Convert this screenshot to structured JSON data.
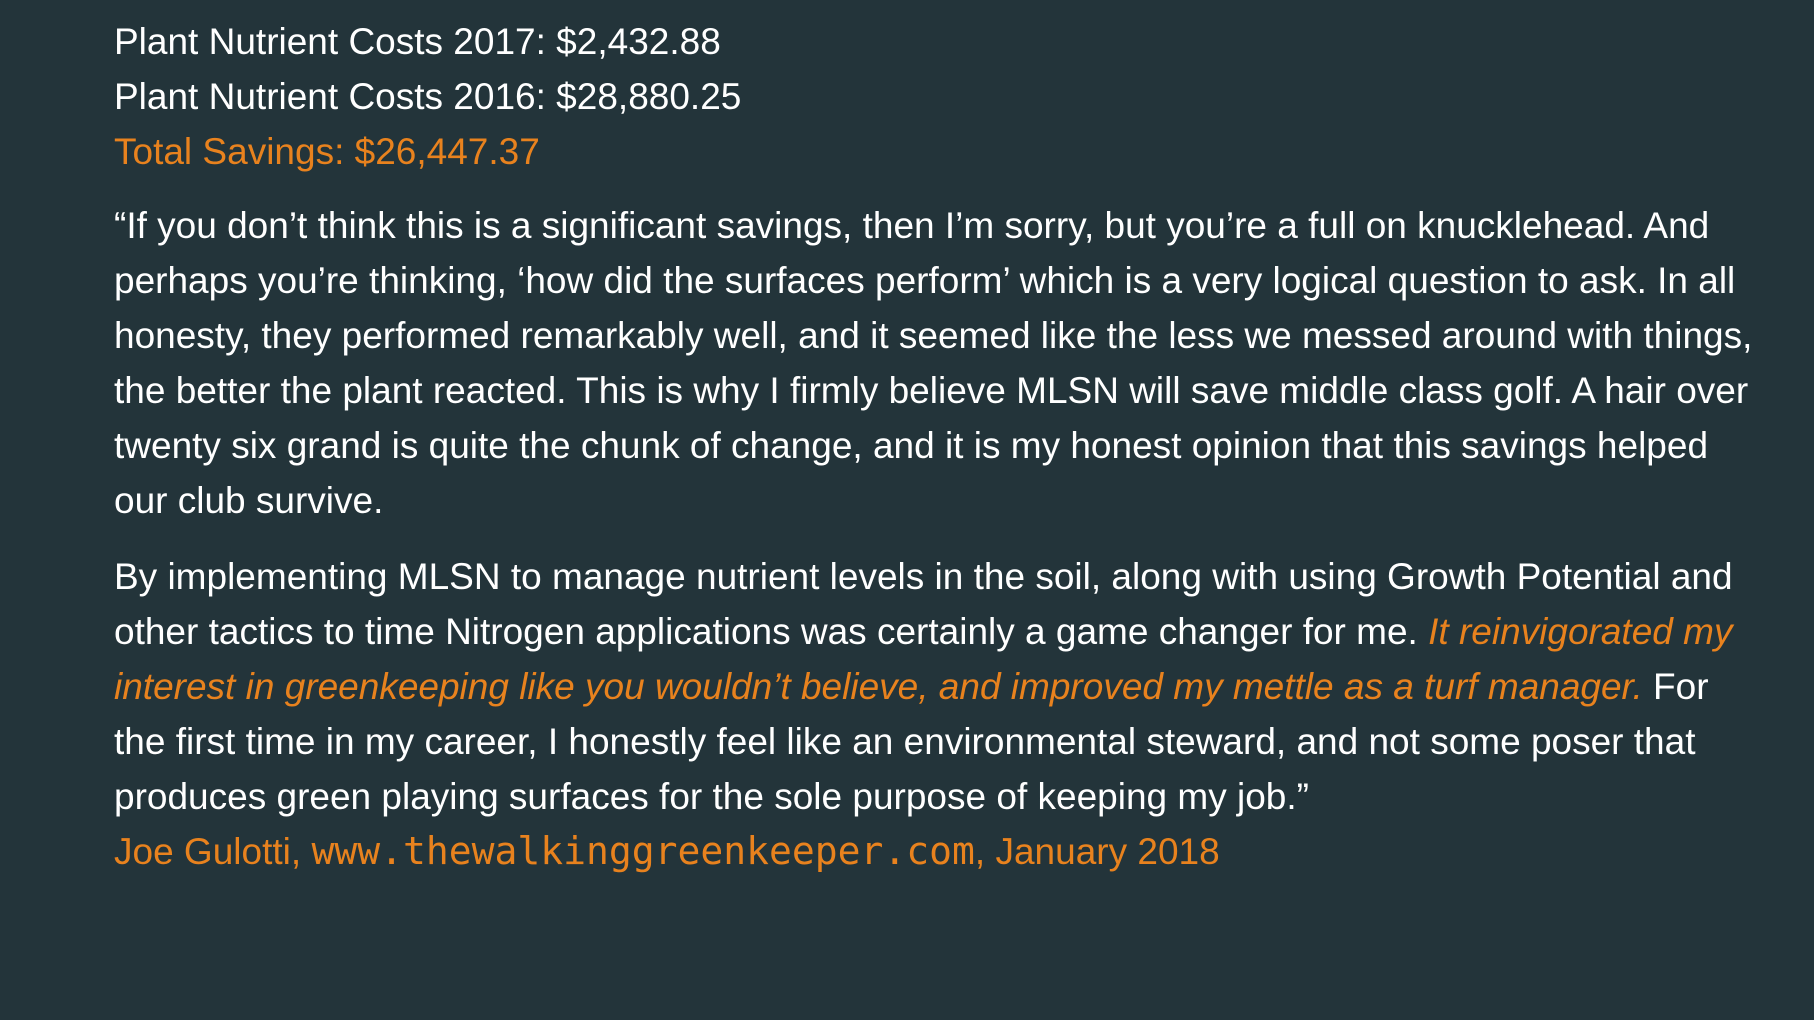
{
  "costs": {
    "line_2017": "Plant Nutrient Costs 2017: $2,432.88",
    "line_2016": "Plant Nutrient Costs 2016: $28,880.25",
    "total_savings": "Total Savings: $26,447.37"
  },
  "quote": {
    "paragraph1": "“If you don’t think this is a significant savings, then I’m sorry, but you’re a full on knucklehead. And perhaps you’re thinking, ‘how did the surfaces perform’ which is a very logical question to ask. In all honesty, they performed remarkably well, and it seemed like the less we messed around with things, the better the plant reacted. This is why I firmly believe MLSN will save middle class golf. A hair over twenty six grand is quite the chunk of change, and it is my honest opinion that this savings helped our club survive.",
    "paragraph2_start": "By implementing MLSN to manage nutrient levels in the soil, along with using Growth Potential and other tactics to time Nitrogen applications was certainly a game changer for me. ",
    "paragraph2_highlight": "It reinvigorated my interest in greenkeeping like you wouldn’t believe, and improved my mettle as a turf manager.",
    "paragraph2_end": " For the first time in my career, I honestly feel like an environmental steward, and not some poser that produces green playing surfaces for the sole purpose of keeping my job.”"
  },
  "attribution": {
    "author": "Joe Gulotti, ",
    "website": "www.thewalkinggreenkeeper.com",
    "date": ", January 2018"
  },
  "colors": {
    "background": "#23343a",
    "text": "#ffffff",
    "accent": "#e8821e"
  }
}
